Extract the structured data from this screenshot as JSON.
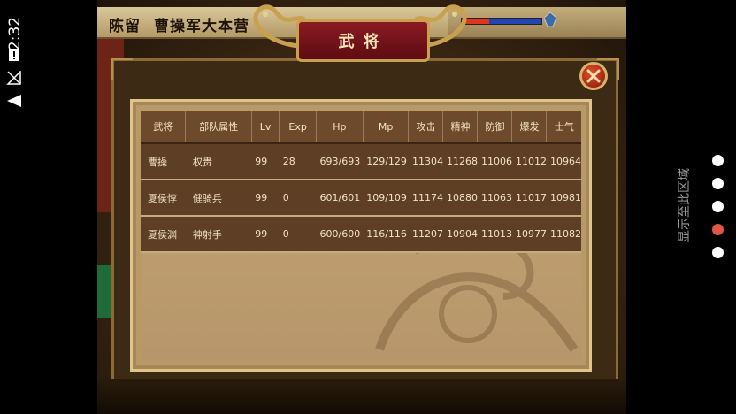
{
  "status_bar": {
    "time": "2:32",
    "icons": [
      "sim-alert-icon",
      "no-signal-icon",
      "wifi-icon"
    ]
  },
  "header": {
    "city": "陈留",
    "camp": "曹操军大本营"
  },
  "dialog": {
    "title": "武将",
    "close_icon": "close-x-icon",
    "columns": [
      "武将",
      "部队属性",
      "Lv",
      "Exp",
      "Hp",
      "Mp",
      "攻击",
      "精神",
      "防御",
      "爆发",
      "士气"
    ],
    "rows": [
      [
        "曹操",
        "权贵",
        "99",
        "28",
        "693/693",
        "129/129",
        "11304",
        "11268",
        "11006",
        "11012",
        "10964"
      ],
      [
        "夏侯惇",
        "健骑兵",
        "99",
        "0",
        "601/601",
        "109/109",
        "11174",
        "10880",
        "11063",
        "11017",
        "10981"
      ],
      [
        "夏侯渊",
        "神射手",
        "99",
        "0",
        "600/600",
        "116/116",
        "11207",
        "10904",
        "11013",
        "10977",
        "11082"
      ]
    ]
  },
  "nav_rail": {
    "label": "显示至此区域",
    "dots": 5,
    "active_index": 3
  },
  "colors": {
    "header_bg": "#c9b585",
    "banner_red": "#7a141b",
    "row_bg": "#5e3f26",
    "panel_bg": "#b89a68",
    "active_dot": "#e15545",
    "hp_fill": "#e0351a",
    "hp_track": "#2146b8"
  }
}
